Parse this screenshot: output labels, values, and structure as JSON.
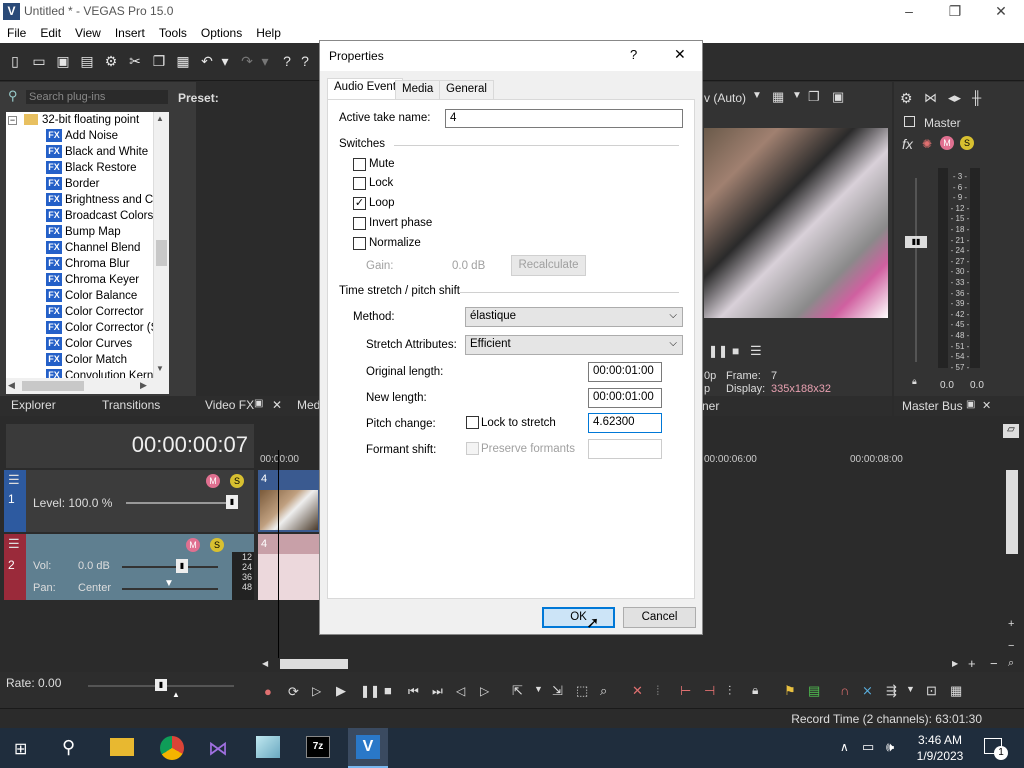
{
  "window": {
    "title": "Untitled * - VEGAS Pro 15.0",
    "app_icon": "V",
    "controls": [
      "–",
      "❐",
      "✕"
    ]
  },
  "menu": [
    "File",
    "Edit",
    "View",
    "Insert",
    "Tools",
    "Options",
    "Help"
  ],
  "plugins": {
    "search_placeholder": "Search plug-ins",
    "preset_label": "Preset:",
    "folder": "32-bit floating point",
    "fx_badge": "FX",
    "items": [
      "Add Noise",
      "Black and White",
      "Black Restore",
      "Border",
      "Brightness and Co",
      "Broadcast Colors",
      "Bump Map",
      "Channel Blend",
      "Chroma Blur",
      "Chroma Keyer",
      "Color Balance",
      "Color Corrector",
      "Color Corrector (S",
      "Color Curves",
      "Color Match",
      "Convolution Kerne"
    ]
  },
  "panel_tabs": {
    "explorer": "Explorer",
    "transitions": "Transitions",
    "video_fx": "Video FX",
    "media_partial": "Medi"
  },
  "preview": {
    "zoom_label": "v (Auto)",
    "frame_label": "0p",
    "frame_text": "Frame:",
    "frame_value": "7",
    "display_prefix": "p",
    "display_label": "Display:",
    "display_value": "335x188x32",
    "tab_partial": "ner"
  },
  "mixer": {
    "master": "Master",
    "scale": [
      "- 3 -",
      "- 6 -",
      "- 9 -",
      "- 12 -",
      "- 15 -",
      "- 18 -",
      "- 21 -",
      "- 24 -",
      "- 27 -",
      "- 30 -",
      "- 33 -",
      "- 36 -",
      "- 39 -",
      "- 42 -",
      "- 45 -",
      "- 48 -",
      "- 51 -",
      "- 54 -",
      "- 57 -"
    ],
    "level_left": "0.0",
    "level_right": "0.0",
    "master_bus_tab": "Master Bus"
  },
  "timeline": {
    "timecode": "00:00:00:07",
    "ruler": [
      "00:00:00",
      "00:00:06:00",
      "00:00:08:00"
    ],
    "track1": {
      "number": "1",
      "level_label": "Level: 100.0 %",
      "event_number": "4"
    },
    "track2": {
      "number": "2",
      "vol_label": "Vol:",
      "vol_value": "0.0 dB",
      "pan_label": "Pan:",
      "pan_value": "Center",
      "meter": [
        "12",
        "24",
        "36",
        "48"
      ],
      "event_number": "4"
    },
    "rate_label": "Rate: 0.00"
  },
  "status": {
    "record_time": "Record Time (2 channels): 63:01:30"
  },
  "taskbar": {
    "time": "3:46 AM",
    "date": "1/9/2023",
    "notification_count": "1"
  },
  "dialog": {
    "title": "Properties",
    "help": "?",
    "close": "✕",
    "tabs": [
      "Audio Event",
      "Media",
      "General"
    ],
    "active_tab": "Audio Event",
    "active_take_label": "Active take name:",
    "active_take_value": "4",
    "switches_label": "Switches",
    "switches": [
      {
        "label": "Mute",
        "checked": false
      },
      {
        "label": "Lock",
        "checked": false
      },
      {
        "label": "Loop",
        "checked": true
      },
      {
        "label": "Invert phase",
        "checked": false
      },
      {
        "label": "Normalize",
        "checked": false
      }
    ],
    "gain_label": "Gain:",
    "gain_value": "0.0 dB",
    "recalculate": "Recalculate",
    "stretch_section": "Time stretch / pitch shift",
    "method_label": "Method:",
    "method_value": "élastique",
    "attributes_label": "Stretch Attributes:",
    "attributes_value": "Efficient",
    "original_length_label": "Original length:",
    "original_length_value": "00:00:01:00",
    "new_length_label": "New length:",
    "new_length_value": "00:00:01:00",
    "pitch_label": "Pitch change:",
    "lock_to_stretch": "Lock to stretch",
    "pitch_value": "4.62300",
    "formant_label": "Formant shift:",
    "preserve_formants": "Preserve formants",
    "ok": "OK",
    "cancel": "Cancel"
  }
}
